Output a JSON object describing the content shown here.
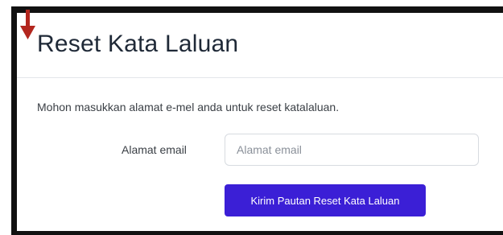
{
  "header": {
    "title": "Reset Kata Laluan"
  },
  "form": {
    "instruction": "Mohon masukkan alamat e-mel anda untuk reset katalaluan.",
    "email_label": "Alamat email",
    "email_placeholder": "Alamat email",
    "email_value": "",
    "submit_label": "Kirim Pautan Reset Kata Laluan"
  },
  "colors": {
    "button_bg": "#3b1fd6",
    "arrow": "#b3261e",
    "border": "#111111"
  },
  "icons": {
    "marker": "arrow-down-icon"
  }
}
